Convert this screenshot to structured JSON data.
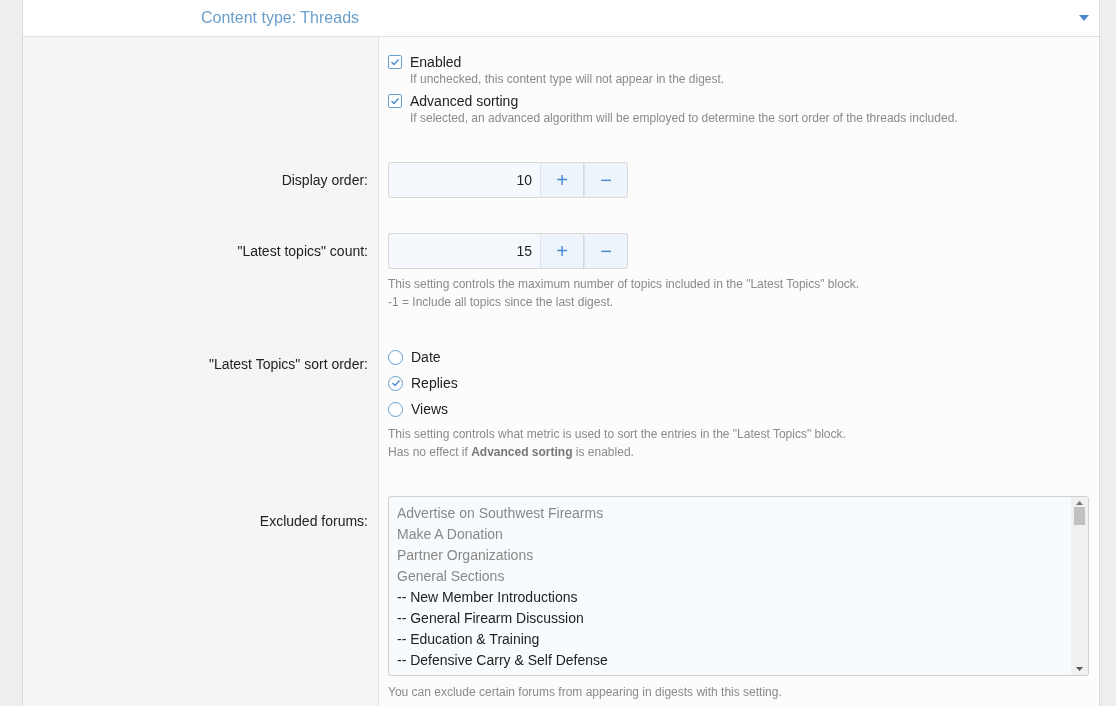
{
  "section": {
    "title": "Content type: Threads",
    "expanded": true
  },
  "options": [
    {
      "label": "Enabled",
      "checked": true,
      "hint": "If unchecked, this content type will not appear in the digest."
    },
    {
      "label": "Advanced sorting",
      "checked": true,
      "hint": "If selected, an advanced algorithm will be employed to determine the sort order of the threads included."
    }
  ],
  "display_order": {
    "label": "Display order:",
    "value": "10",
    "increment": "+",
    "decrement": "−"
  },
  "latest_count": {
    "label": "\"Latest topics\" count:",
    "value": "15",
    "increment": "+",
    "decrement": "−",
    "hints": [
      "This setting controls the maximum number of topics included in the \"Latest Topics\" block.",
      "-1 = Include all topics since the last digest."
    ]
  },
  "sort_order": {
    "label": "\"Latest Topics\" sort order:",
    "choices": [
      {
        "label": "Date",
        "selected": false
      },
      {
        "label": "Replies",
        "selected": true
      },
      {
        "label": "Views",
        "selected": false
      }
    ],
    "hints": [
      "This setting controls what metric is used to sort the entries in the \"Latest Topics\" block.",
      "Has no effect if **Advanced sorting** is enabled."
    ]
  },
  "excluded_forums": {
    "label": "Excluded forums:",
    "items": [
      {
        "label": "Advertise on Southwest Firearms",
        "disabled": true
      },
      {
        "label": "Make A Donation",
        "disabled": true
      },
      {
        "label": "Partner Organizations",
        "disabled": true
      },
      {
        "label": "General Sections",
        "disabled": true
      },
      {
        "label": "-- New Member Introductions",
        "disabled": false
      },
      {
        "label": "-- General Firearm Discussion",
        "disabled": false
      },
      {
        "label": "-- Education & Training",
        "disabled": false
      },
      {
        "label": "-- Defensive Carry & Self Defense",
        "disabled": false
      }
    ],
    "hint": "You can exclude certain forums from appearing in digests with this setting."
  }
}
